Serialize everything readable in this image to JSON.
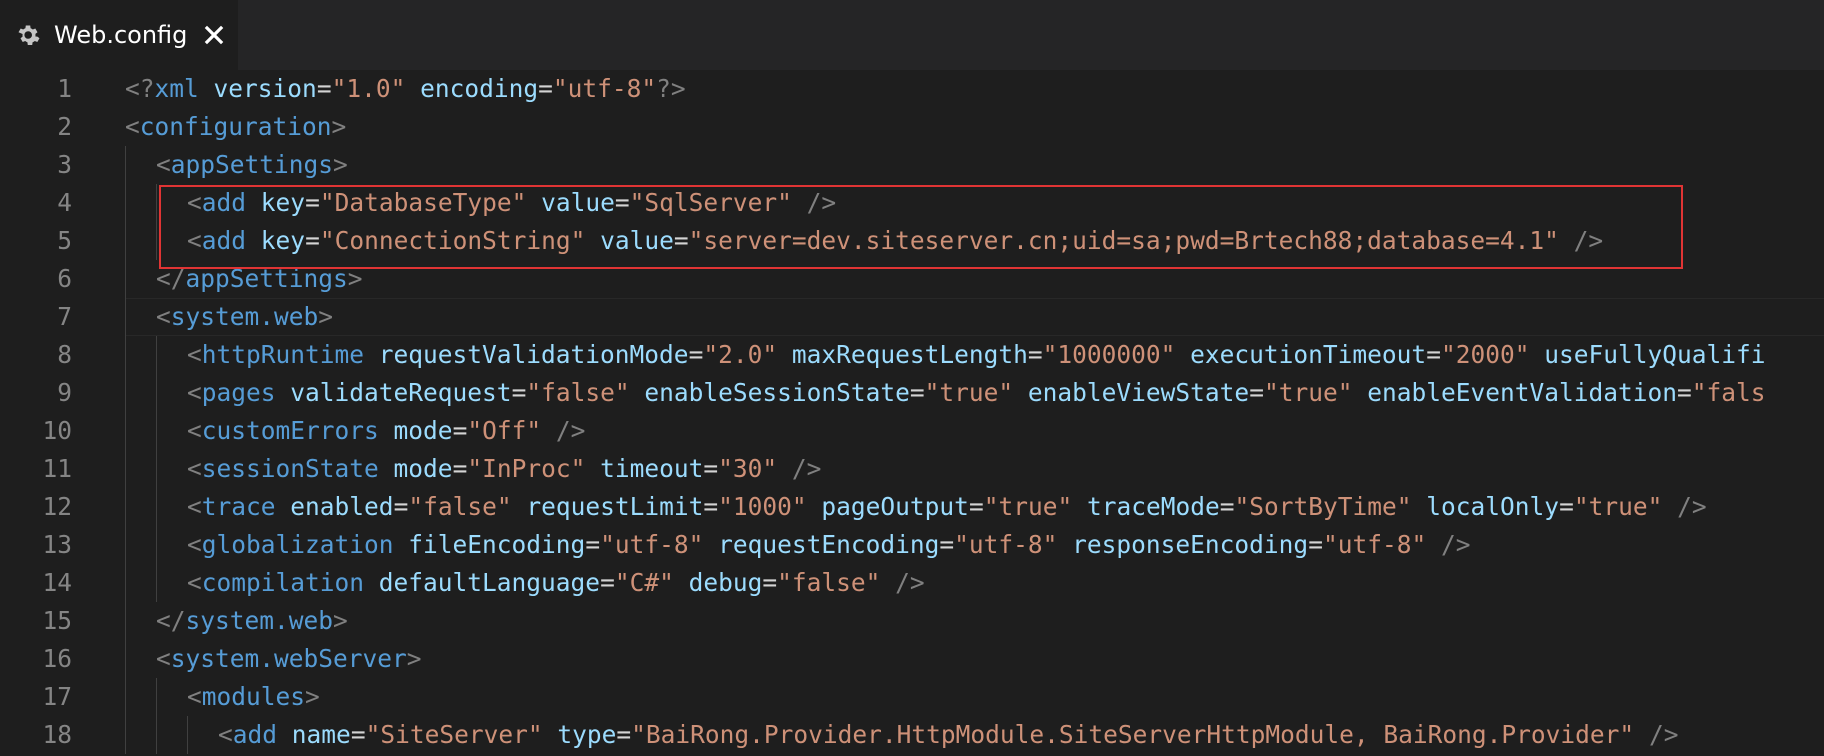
{
  "tab": {
    "label": "Web.config",
    "icon": "gear-icon",
    "close_icon": "close-icon"
  },
  "highlight": {
    "color": "#e03434"
  },
  "colors": {
    "background": "#1e1e1e",
    "tag": "#569cd6",
    "attribute": "#9cdcfe",
    "string": "#ce9178",
    "punctuation": "#808080",
    "line_number": "#858585"
  },
  "lines": [
    {
      "number": "1",
      "indent": 0,
      "tokens": [
        {
          "t": "punct",
          "v": "<?"
        },
        {
          "t": "tag",
          "v": "xml"
        },
        {
          "t": "text",
          "v": " "
        },
        {
          "t": "attr",
          "v": "version"
        },
        {
          "t": "eq",
          "v": "="
        },
        {
          "t": "str",
          "v": "\"1.0\""
        },
        {
          "t": "text",
          "v": " "
        },
        {
          "t": "attr",
          "v": "encoding"
        },
        {
          "t": "eq",
          "v": "="
        },
        {
          "t": "str",
          "v": "\"utf-8\""
        },
        {
          "t": "punct",
          "v": "?>"
        }
      ]
    },
    {
      "number": "2",
      "indent": 0,
      "tokens": [
        {
          "t": "punct",
          "v": "<"
        },
        {
          "t": "tag",
          "v": "configuration"
        },
        {
          "t": "punct",
          "v": ">"
        }
      ]
    },
    {
      "number": "3",
      "indent": 1,
      "tokens": [
        {
          "t": "punct",
          "v": "<"
        },
        {
          "t": "tag",
          "v": "appSettings"
        },
        {
          "t": "punct",
          "v": ">"
        }
      ]
    },
    {
      "number": "4",
      "indent": 2,
      "tokens": [
        {
          "t": "punct",
          "v": "<"
        },
        {
          "t": "tag",
          "v": "add"
        },
        {
          "t": "text",
          "v": " "
        },
        {
          "t": "attr",
          "v": "key"
        },
        {
          "t": "eq",
          "v": "="
        },
        {
          "t": "str",
          "v": "\"DatabaseType\""
        },
        {
          "t": "text",
          "v": " "
        },
        {
          "t": "attr",
          "v": "value"
        },
        {
          "t": "eq",
          "v": "="
        },
        {
          "t": "str",
          "v": "\"SqlServer\""
        },
        {
          "t": "text",
          "v": " "
        },
        {
          "t": "punct",
          "v": "/>"
        }
      ]
    },
    {
      "number": "5",
      "indent": 2,
      "tokens": [
        {
          "t": "punct",
          "v": "<"
        },
        {
          "t": "tag",
          "v": "add"
        },
        {
          "t": "text",
          "v": " "
        },
        {
          "t": "attr",
          "v": "key"
        },
        {
          "t": "eq",
          "v": "="
        },
        {
          "t": "str",
          "v": "\"ConnectionString\""
        },
        {
          "t": "text",
          "v": " "
        },
        {
          "t": "attr",
          "v": "value"
        },
        {
          "t": "eq",
          "v": "="
        },
        {
          "t": "str",
          "v": "\"server=dev.siteserver.cn;uid=sa;pwd=Brtech88;database=4.1\""
        },
        {
          "t": "text",
          "v": " "
        },
        {
          "t": "punct",
          "v": "/>"
        }
      ]
    },
    {
      "number": "6",
      "indent": 1,
      "tokens": [
        {
          "t": "punct",
          "v": "</"
        },
        {
          "t": "tag",
          "v": "appSettings"
        },
        {
          "t": "punct",
          "v": ">"
        }
      ]
    },
    {
      "number": "7",
      "indent": 1,
      "tokens": [
        {
          "t": "punct",
          "v": "<"
        },
        {
          "t": "tag",
          "v": "system.web"
        },
        {
          "t": "punct",
          "v": ">"
        }
      ]
    },
    {
      "number": "8",
      "indent": 2,
      "tokens": [
        {
          "t": "punct",
          "v": "<"
        },
        {
          "t": "tag",
          "v": "httpRuntime"
        },
        {
          "t": "text",
          "v": " "
        },
        {
          "t": "attr",
          "v": "requestValidationMode"
        },
        {
          "t": "eq",
          "v": "="
        },
        {
          "t": "str",
          "v": "\"2.0\""
        },
        {
          "t": "text",
          "v": " "
        },
        {
          "t": "attr",
          "v": "maxRequestLength"
        },
        {
          "t": "eq",
          "v": "="
        },
        {
          "t": "str",
          "v": "\"1000000\""
        },
        {
          "t": "text",
          "v": " "
        },
        {
          "t": "attr",
          "v": "executionTimeout"
        },
        {
          "t": "eq",
          "v": "="
        },
        {
          "t": "str",
          "v": "\"2000\""
        },
        {
          "t": "text",
          "v": " "
        },
        {
          "t": "attr",
          "v": "useFullyQualifi"
        }
      ]
    },
    {
      "number": "9",
      "indent": 2,
      "tokens": [
        {
          "t": "punct",
          "v": "<"
        },
        {
          "t": "tag",
          "v": "pages"
        },
        {
          "t": "text",
          "v": " "
        },
        {
          "t": "attr",
          "v": "validateRequest"
        },
        {
          "t": "eq",
          "v": "="
        },
        {
          "t": "str",
          "v": "\"false\""
        },
        {
          "t": "text",
          "v": " "
        },
        {
          "t": "attr",
          "v": "enableSessionState"
        },
        {
          "t": "eq",
          "v": "="
        },
        {
          "t": "str",
          "v": "\"true\""
        },
        {
          "t": "text",
          "v": " "
        },
        {
          "t": "attr",
          "v": "enableViewState"
        },
        {
          "t": "eq",
          "v": "="
        },
        {
          "t": "str",
          "v": "\"true\""
        },
        {
          "t": "text",
          "v": " "
        },
        {
          "t": "attr",
          "v": "enableEventValidation"
        },
        {
          "t": "eq",
          "v": "="
        },
        {
          "t": "str",
          "v": "\"fals"
        }
      ]
    },
    {
      "number": "10",
      "indent": 2,
      "tokens": [
        {
          "t": "punct",
          "v": "<"
        },
        {
          "t": "tag",
          "v": "customErrors"
        },
        {
          "t": "text",
          "v": " "
        },
        {
          "t": "attr",
          "v": "mode"
        },
        {
          "t": "eq",
          "v": "="
        },
        {
          "t": "str",
          "v": "\"Off\""
        },
        {
          "t": "text",
          "v": " "
        },
        {
          "t": "punct",
          "v": "/>"
        }
      ]
    },
    {
      "number": "11",
      "indent": 2,
      "tokens": [
        {
          "t": "punct",
          "v": "<"
        },
        {
          "t": "tag",
          "v": "sessionState"
        },
        {
          "t": "text",
          "v": " "
        },
        {
          "t": "attr",
          "v": "mode"
        },
        {
          "t": "eq",
          "v": "="
        },
        {
          "t": "str",
          "v": "\"InProc\""
        },
        {
          "t": "text",
          "v": " "
        },
        {
          "t": "attr",
          "v": "timeout"
        },
        {
          "t": "eq",
          "v": "="
        },
        {
          "t": "str",
          "v": "\"30\""
        },
        {
          "t": "text",
          "v": " "
        },
        {
          "t": "punct",
          "v": "/>"
        }
      ]
    },
    {
      "number": "12",
      "indent": 2,
      "tokens": [
        {
          "t": "punct",
          "v": "<"
        },
        {
          "t": "tag",
          "v": "trace"
        },
        {
          "t": "text",
          "v": " "
        },
        {
          "t": "attr",
          "v": "enabled"
        },
        {
          "t": "eq",
          "v": "="
        },
        {
          "t": "str",
          "v": "\"false\""
        },
        {
          "t": "text",
          "v": " "
        },
        {
          "t": "attr",
          "v": "requestLimit"
        },
        {
          "t": "eq",
          "v": "="
        },
        {
          "t": "str",
          "v": "\"1000\""
        },
        {
          "t": "text",
          "v": " "
        },
        {
          "t": "attr",
          "v": "pageOutput"
        },
        {
          "t": "eq",
          "v": "="
        },
        {
          "t": "str",
          "v": "\"true\""
        },
        {
          "t": "text",
          "v": " "
        },
        {
          "t": "attr",
          "v": "traceMode"
        },
        {
          "t": "eq",
          "v": "="
        },
        {
          "t": "str",
          "v": "\"SortByTime\""
        },
        {
          "t": "text",
          "v": " "
        },
        {
          "t": "attr",
          "v": "localOnly"
        },
        {
          "t": "eq",
          "v": "="
        },
        {
          "t": "str",
          "v": "\"true\""
        },
        {
          "t": "text",
          "v": " "
        },
        {
          "t": "punct",
          "v": "/>"
        }
      ]
    },
    {
      "number": "13",
      "indent": 2,
      "tokens": [
        {
          "t": "punct",
          "v": "<"
        },
        {
          "t": "tag",
          "v": "globalization"
        },
        {
          "t": "text",
          "v": " "
        },
        {
          "t": "attr",
          "v": "fileEncoding"
        },
        {
          "t": "eq",
          "v": "="
        },
        {
          "t": "str",
          "v": "\"utf-8\""
        },
        {
          "t": "text",
          "v": " "
        },
        {
          "t": "attr",
          "v": "requestEncoding"
        },
        {
          "t": "eq",
          "v": "="
        },
        {
          "t": "str",
          "v": "\"utf-8\""
        },
        {
          "t": "text",
          "v": " "
        },
        {
          "t": "attr",
          "v": "responseEncoding"
        },
        {
          "t": "eq",
          "v": "="
        },
        {
          "t": "str",
          "v": "\"utf-8\""
        },
        {
          "t": "text",
          "v": " "
        },
        {
          "t": "punct",
          "v": "/>"
        }
      ]
    },
    {
      "number": "14",
      "indent": 2,
      "tokens": [
        {
          "t": "punct",
          "v": "<"
        },
        {
          "t": "tag",
          "v": "compilation"
        },
        {
          "t": "text",
          "v": " "
        },
        {
          "t": "attr",
          "v": "defaultLanguage"
        },
        {
          "t": "eq",
          "v": "="
        },
        {
          "t": "str",
          "v": "\"C#\""
        },
        {
          "t": "text",
          "v": " "
        },
        {
          "t": "attr",
          "v": "debug"
        },
        {
          "t": "eq",
          "v": "="
        },
        {
          "t": "str",
          "v": "\"false\""
        },
        {
          "t": "text",
          "v": " "
        },
        {
          "t": "punct",
          "v": "/>"
        }
      ]
    },
    {
      "number": "15",
      "indent": 1,
      "tokens": [
        {
          "t": "punct",
          "v": "</"
        },
        {
          "t": "tag",
          "v": "system.web"
        },
        {
          "t": "punct",
          "v": ">"
        }
      ]
    },
    {
      "number": "16",
      "indent": 1,
      "tokens": [
        {
          "t": "punct",
          "v": "<"
        },
        {
          "t": "tag",
          "v": "system.webServer"
        },
        {
          "t": "punct",
          "v": ">"
        }
      ]
    },
    {
      "number": "17",
      "indent": 2,
      "tokens": [
        {
          "t": "punct",
          "v": "<"
        },
        {
          "t": "tag",
          "v": "modules"
        },
        {
          "t": "punct",
          "v": ">"
        }
      ]
    },
    {
      "number": "18",
      "indent": 3,
      "tokens": [
        {
          "t": "punct",
          "v": "<"
        },
        {
          "t": "tag",
          "v": "add"
        },
        {
          "t": "text",
          "v": " "
        },
        {
          "t": "attr",
          "v": "name"
        },
        {
          "t": "eq",
          "v": "="
        },
        {
          "t": "str",
          "v": "\"SiteServer\""
        },
        {
          "t": "text",
          "v": " "
        },
        {
          "t": "attr",
          "v": "type"
        },
        {
          "t": "eq",
          "v": "="
        },
        {
          "t": "str",
          "v": "\"BaiRong.Provider.HttpModule.SiteServerHttpModule, BaiRong.Provider\""
        },
        {
          "t": "text",
          "v": " "
        },
        {
          "t": "punct",
          "v": "/>"
        }
      ]
    }
  ]
}
